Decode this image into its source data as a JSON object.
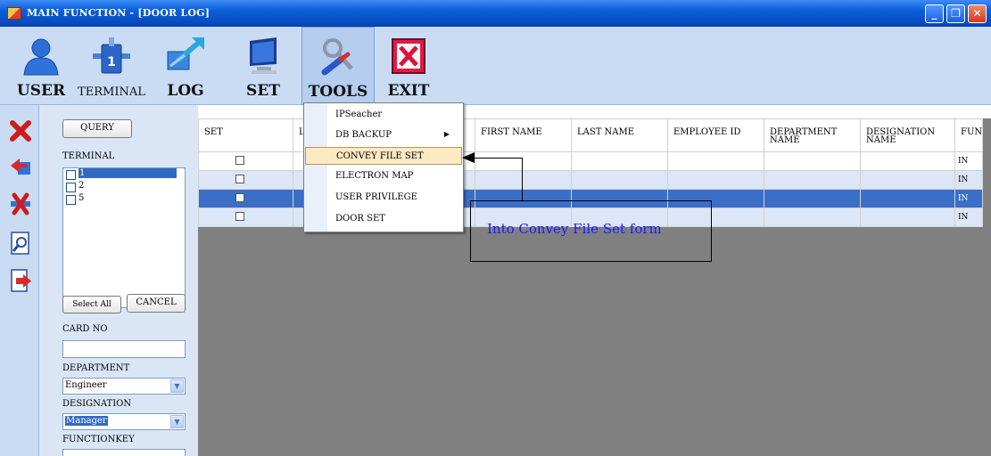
{
  "window": {
    "title": "MAIN FUNCTION - [DOOR LOG]",
    "controls": [
      "minimize",
      "restore",
      "close"
    ]
  },
  "toolbar": {
    "items": [
      {
        "label": "USER",
        "icon": "user-icon"
      },
      {
        "label": "TERMINAL",
        "icon": "terminal-icon"
      },
      {
        "label": "LOG",
        "icon": "log-icon"
      },
      {
        "label": "SET",
        "icon": "monitor-icon"
      },
      {
        "label": "TOOLS",
        "icon": "tools-icon"
      },
      {
        "label": "EXIT",
        "icon": "exit-icon"
      }
    ]
  },
  "left_strip": {
    "icons": [
      "delete-icon",
      "import-icon",
      "clear-icon",
      "preview-icon",
      "export-icon"
    ]
  },
  "filter": {
    "query_label": "QUERY",
    "terminal_label": "TERMINAL",
    "terminals": [
      {
        "label": "1",
        "selected": true
      },
      {
        "label": "2",
        "selected": false
      },
      {
        "label": "5",
        "selected": false
      }
    ],
    "select_all_label": "Select All",
    "cancel_label": "CANCEL",
    "card_no_label": "CARD NO",
    "card_no_value": "",
    "department_label": "DEPARTMENT",
    "department_value": "Engineer",
    "designation_label": "DESIGNATION",
    "designation_value": "Manager",
    "functionkey_label": "FUNCTIONKEY"
  },
  "grid": {
    "columns": [
      "SET",
      "LA",
      "",
      "FIRST NAME",
      "LAST NAME",
      "EMPLOYEE ID",
      "DEPARTMENT NAME",
      "DESIGNATION NAME",
      "FUN"
    ],
    "rows": [
      {
        "fun": "IN"
      },
      {
        "fun": "IN"
      },
      {
        "fun": "IN"
      },
      {
        "fun": "IN"
      }
    ]
  },
  "tools_menu": {
    "items": [
      {
        "label": "IPSeacher",
        "submenu": false,
        "active": false
      },
      {
        "label": "DB BACKUP",
        "submenu": true,
        "active": false
      },
      {
        "label": "CONVEY FILE SET",
        "submenu": false,
        "active": true
      },
      {
        "label": "ELECTRON MAP",
        "submenu": false,
        "active": false
      },
      {
        "label": "USER PRIVILEGE",
        "submenu": false,
        "active": false
      },
      {
        "label": "DOOR SET",
        "submenu": false,
        "active": false
      }
    ]
  },
  "annotation": {
    "text": "Into Convey File Set form"
  },
  "colors": {
    "titlebar": "#0a5fd8",
    "toolbar_bg": "#c9dcf4",
    "selection": "#316ac5",
    "annotation_text": "#1a1aff"
  }
}
